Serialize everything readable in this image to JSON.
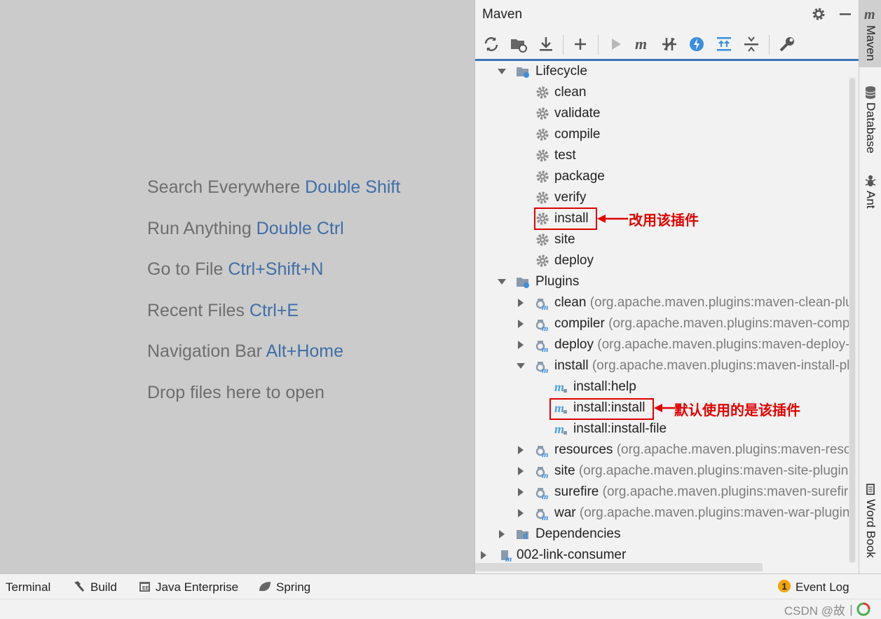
{
  "editor": {
    "hints": [
      {
        "text": "Search Everywhere ",
        "key": "Double Shift"
      },
      {
        "text": "Run Anything ",
        "key": "Double Ctrl"
      },
      {
        "text": "Go to File ",
        "key": "Ctrl+Shift+N"
      },
      {
        "text": "Recent Files ",
        "key": "Ctrl+E"
      },
      {
        "text": "Navigation Bar ",
        "key": "Alt+Home"
      },
      {
        "text": "Drop files here to open",
        "key": ""
      }
    ]
  },
  "maven": {
    "title": "Maven",
    "toolbar": [
      "reload-icon",
      "folder-reload-icon",
      "download-icon",
      "add-icon",
      "run-icon",
      "maven-goal-icon",
      "toggle-offline-icon",
      "skip-tests-icon",
      "show-dependencies-icon",
      "collapse-all-icon",
      "settings-wrench-icon"
    ],
    "tree": {
      "lifecycle": {
        "label": "Lifecycle",
        "phases": [
          "clean",
          "validate",
          "compile",
          "test",
          "package",
          "verify",
          "install",
          "site",
          "deploy"
        ]
      },
      "plugins": {
        "label": "Plugins",
        "items": [
          {
            "name": "clean",
            "detail": " (org.apache.maven.plugins:maven-clean-plugin",
            "expanded": false
          },
          {
            "name": "compiler",
            "detail": " (org.apache.maven.plugins:maven-compiler",
            "expanded": false
          },
          {
            "name": "deploy",
            "detail": " (org.apache.maven.plugins:maven-deploy-plugin",
            "expanded": false
          },
          {
            "name": "install",
            "detail": " (org.apache.maven.plugins:maven-install-plugin",
            "expanded": true
          },
          {
            "name": "resources",
            "detail": " (org.apache.maven.plugins:maven-resources",
            "expanded": false
          },
          {
            "name": "site",
            "detail": " (org.apache.maven.plugins:maven-site-plugin:",
            "expanded": false
          },
          {
            "name": "surefire",
            "detail": " (org.apache.maven.plugins:maven-surefire-",
            "expanded": false
          },
          {
            "name": "war",
            "detail": " (org.apache.maven.plugins:maven-war-plugin:",
            "expanded": false
          }
        ],
        "install_goals": [
          "install:help",
          "install:install",
          "install:install-file"
        ]
      },
      "dependencies": {
        "label": "Dependencies"
      },
      "project": {
        "label": "002-link-consumer"
      }
    }
  },
  "annotations": {
    "lifecycle_install": "改用该插件",
    "goal_install": "默认使用的是该插件"
  },
  "stripe": {
    "maven": "Maven",
    "database": "Database",
    "ant": "Ant",
    "wordbook": "Word Book"
  },
  "bottombar": {
    "terminal": "Terminal",
    "build": "Build",
    "java_enterprise": "Java Enterprise",
    "spring": "Spring",
    "event_log": "Event Log",
    "event_count": "1"
  },
  "watermark": "CSDN @故丨",
  "colors": {
    "accent": "#3e74b8",
    "annotation": "#e00000",
    "key_hint": "#3f6ea6"
  }
}
